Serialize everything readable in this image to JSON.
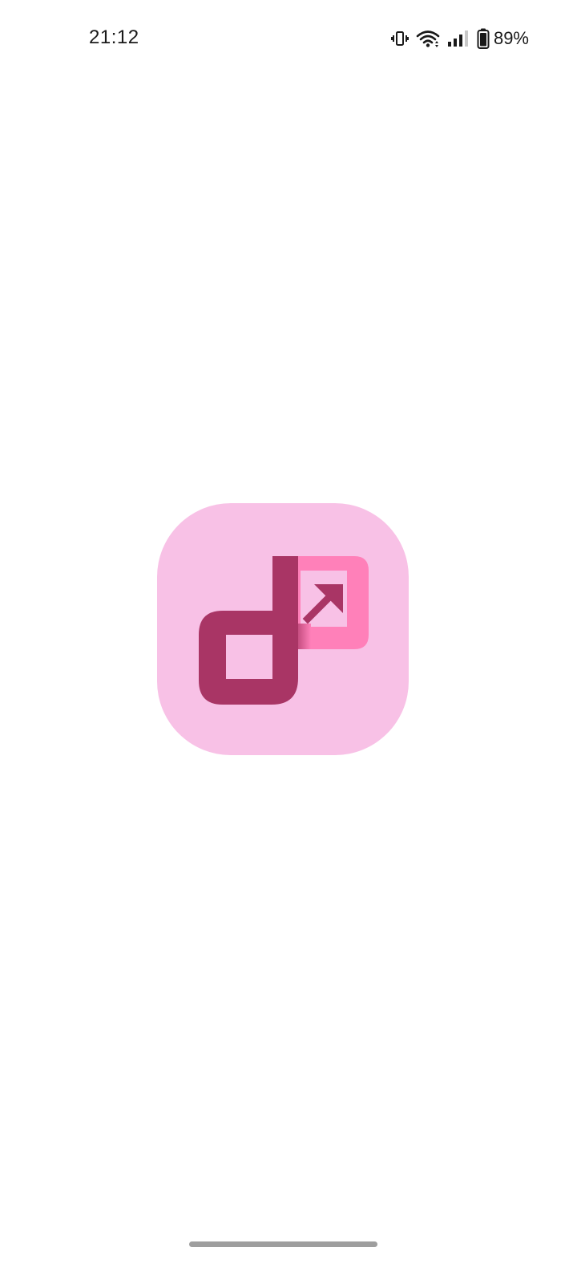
{
  "status_bar": {
    "time": "21:12",
    "battery_percent": "89%",
    "icons": [
      "vibrate-icon",
      "wifi-icon",
      "signal-icon",
      "battery-icon"
    ],
    "battery_level": 0.89
  },
  "splash": {
    "logo_icon": "app-logo-icon",
    "colors": {
      "background": "#ffffff",
      "logo_tile": "#f8c1e6",
      "logo_primary": "#a93565",
      "logo_accent": "#ff80b9"
    }
  }
}
